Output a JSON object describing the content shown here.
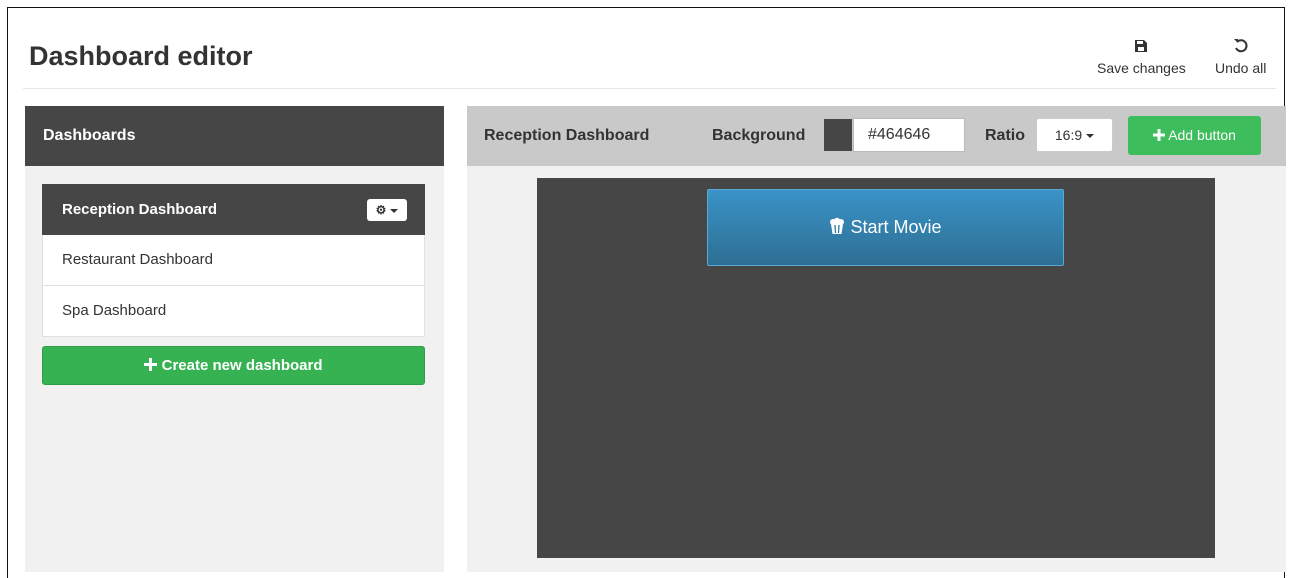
{
  "header": {
    "title": "Dashboard editor",
    "save_label": "Save changes",
    "undo_label": "Undo all"
  },
  "sidebar": {
    "title": "Dashboards",
    "items": [
      {
        "label": "Reception Dashboard",
        "active": true
      },
      {
        "label": "Restaurant Dashboard",
        "active": false
      },
      {
        "label": "Spa Dashboard",
        "active": false
      }
    ],
    "create_label": "Create new dashboard"
  },
  "editor": {
    "dashboard_name": "Reception Dashboard",
    "background_label": "Background",
    "background_value": "#464646",
    "ratio_label": "Ratio",
    "ratio_value": "16:9",
    "add_button_label": "Add button",
    "buttons": [
      {
        "label": "Start Movie",
        "icon": "popcorn-icon"
      }
    ]
  },
  "colors": {
    "dark": "#464646",
    "green": "#36b252",
    "blue": "#337ab7"
  }
}
